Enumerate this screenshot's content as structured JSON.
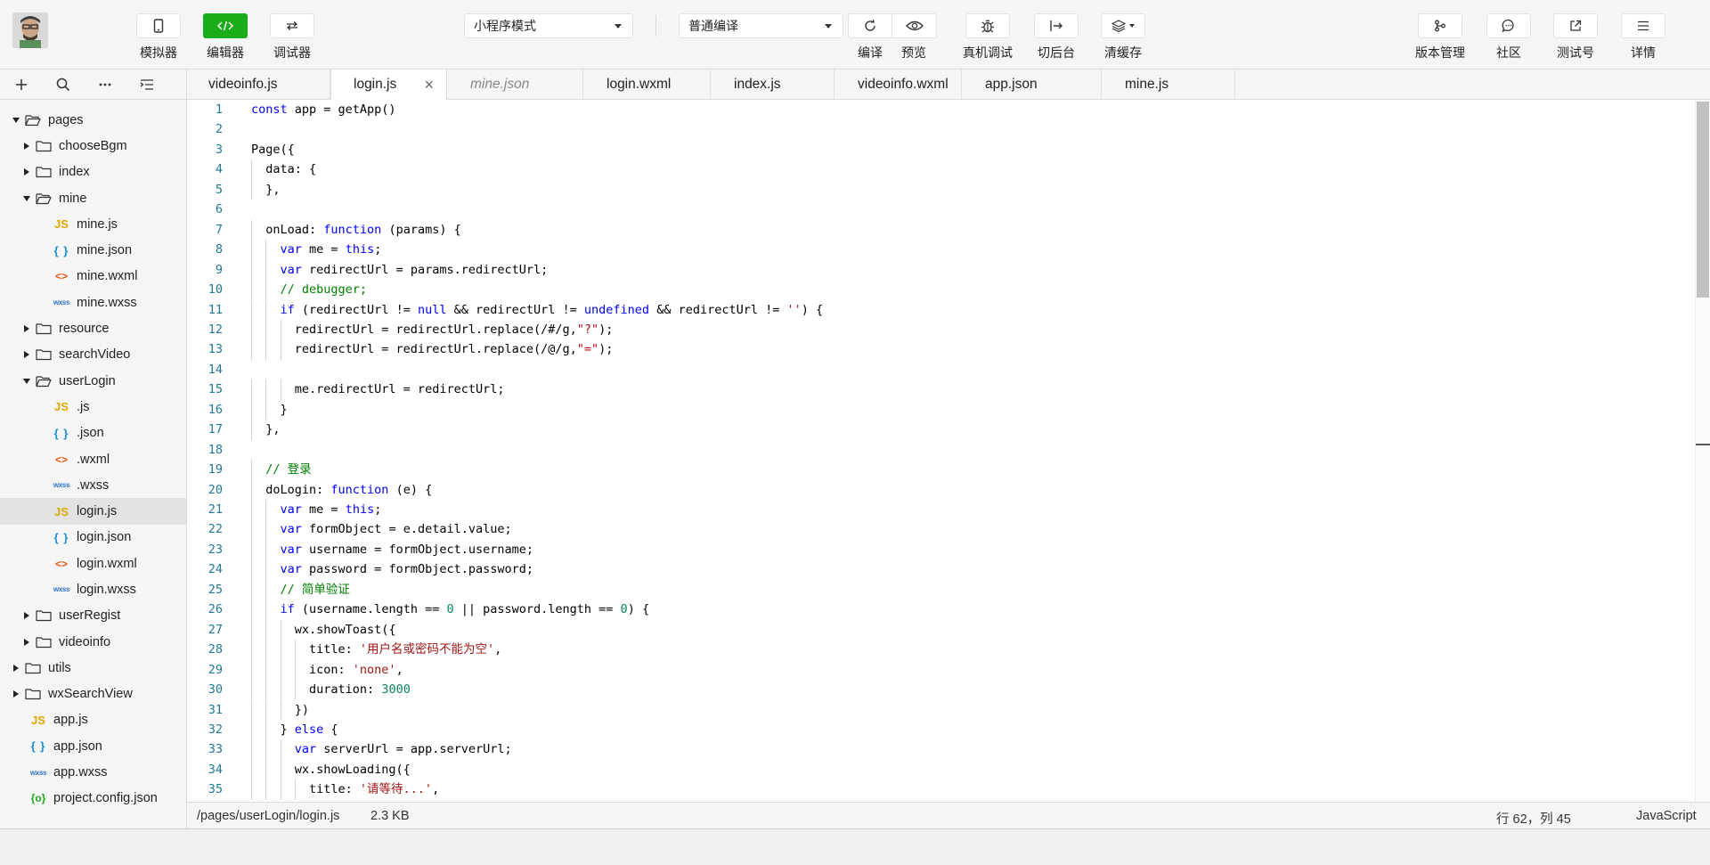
{
  "toolbar": {
    "simulator": "模拟器",
    "editor": "编辑器",
    "debugger": "调试器",
    "mode_select": "小程序模式",
    "compile_select": "普通编译",
    "compile": "编译",
    "preview": "预览",
    "remote_debug": "真机调试",
    "background": "切后台",
    "clear_cache": "清缓存",
    "version_mgmt": "版本管理",
    "community": "社区",
    "test_account": "测试号",
    "details": "详情"
  },
  "sidebar": {
    "tree": [
      {
        "name": "pages",
        "type": "folder",
        "depth": 0,
        "state": "open"
      },
      {
        "name": "chooseBgm",
        "type": "folder",
        "depth": 1,
        "state": "closed"
      },
      {
        "name": "index",
        "type": "folder",
        "depth": 1,
        "state": "closed"
      },
      {
        "name": "mine",
        "type": "folder",
        "depth": 1,
        "state": "open"
      },
      {
        "name": "mine.js",
        "type": "js",
        "depth": 2
      },
      {
        "name": "mine.json",
        "type": "json",
        "depth": 2
      },
      {
        "name": "mine.wxml",
        "type": "wxml",
        "depth": 2
      },
      {
        "name": "mine.wxss",
        "type": "wxss",
        "depth": 2
      },
      {
        "name": "resource",
        "type": "folder",
        "depth": 1,
        "state": "closed"
      },
      {
        "name": "searchVideo",
        "type": "folder",
        "depth": 1,
        "state": "closed"
      },
      {
        "name": "userLogin",
        "type": "folder",
        "depth": 1,
        "state": "open"
      },
      {
        "name": ".js",
        "type": "js",
        "depth": 2
      },
      {
        "name": ".json",
        "type": "json",
        "depth": 2
      },
      {
        "name": ".wxml",
        "type": "wxml",
        "depth": 2
      },
      {
        "name": ".wxss",
        "type": "wxss",
        "depth": 2
      },
      {
        "name": "login.js",
        "type": "js",
        "depth": 2,
        "selected": true
      },
      {
        "name": "login.json",
        "type": "json",
        "depth": 2
      },
      {
        "name": "login.wxml",
        "type": "wxml",
        "depth": 2
      },
      {
        "name": "login.wxss",
        "type": "wxss",
        "depth": 2
      },
      {
        "name": "userRegist",
        "type": "folder",
        "depth": 1,
        "state": "closed"
      },
      {
        "name": "videoinfo",
        "type": "folder",
        "depth": 1,
        "state": "closed"
      },
      {
        "name": "utils",
        "type": "folder",
        "depth": 0,
        "state": "closed"
      },
      {
        "name": "wxSearchView",
        "type": "folder",
        "depth": 0,
        "state": "closed"
      },
      {
        "name": "app.js",
        "type": "js",
        "depth": 1
      },
      {
        "name": "app.json",
        "type": "json",
        "depth": 1
      },
      {
        "name": "app.wxss",
        "type": "wxss",
        "depth": 1
      },
      {
        "name": "project.config.json",
        "type": "cfg",
        "depth": 1
      }
    ],
    "icons": {
      "js": "JS",
      "json": "{ }",
      "wxml": "<>",
      "wxss": "wxss",
      "cfg": "{o}"
    }
  },
  "tabs": [
    {
      "label": "videoinfo.js"
    },
    {
      "label": "login.js",
      "active": true
    },
    {
      "label": "mine.json",
      "italic": true
    },
    {
      "label": "login.wxml"
    },
    {
      "label": "index.js"
    },
    {
      "label": "videoinfo.wxml"
    },
    {
      "label": "app.json"
    },
    {
      "label": "mine.js"
    }
  ],
  "editor": {
    "language": "JavaScript",
    "lines": [
      "const app = getApp()",
      "",
      "Page({",
      "  data: {",
      "  },",
      "",
      "  onLoad: function (params) {",
      "    var me = this;",
      "    var redirectUrl = params.redirectUrl;",
      "    // debugger;",
      "    if (redirectUrl != null && redirectUrl != undefined && redirectUrl != '') {",
      "      redirectUrl = redirectUrl.replace(/#/g,\"?\");",
      "      redirectUrl = redirectUrl.replace(/@/g,\"=\");",
      "",
      "      me.redirectUrl = redirectUrl;",
      "    }",
      "  },",
      "",
      "  // 登录",
      "  doLogin: function (e) {",
      "    var me = this;",
      "    var formObject = e.detail.value;",
      "    var username = formObject.username;",
      "    var password = formObject.password;",
      "    // 简单验证",
      "    if (username.length == 0 || password.length == 0) {",
      "      wx.showToast({",
      "        title: '用户名或密码不能为空',",
      "        icon: 'none',",
      "        duration: 3000",
      "      })",
      "    } else {",
      "      var serverUrl = app.serverUrl;",
      "      wx.showLoading({",
      "        title: '请等待...',"
    ]
  },
  "statusbar": {
    "path": "/pages/userLogin/login.js",
    "size": "2.3 KB",
    "cursor": "行 62，列 45",
    "language": "JavaScript"
  }
}
